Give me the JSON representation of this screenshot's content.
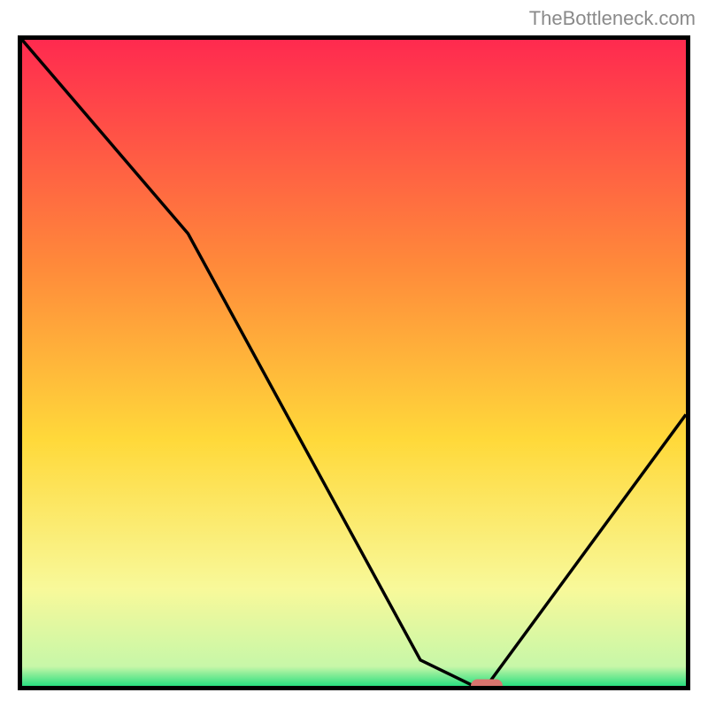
{
  "watermark": "TheBottleneck.com",
  "colors": {
    "border": "#000000",
    "curve": "#000000",
    "marker": "#d9746e",
    "gradient_top": "#ff2a4f",
    "gradient_mid_upper": "#ff8a3a",
    "gradient_mid": "#ffd93a",
    "gradient_lower": "#f8f99a",
    "gradient_bottom": "#2ade7f"
  },
  "chart_data": {
    "type": "line",
    "title": "",
    "xlabel": "",
    "ylabel": "",
    "xlim": [
      0,
      100
    ],
    "ylim": [
      0,
      100
    ],
    "x": [
      0,
      25,
      60,
      68,
      70,
      100
    ],
    "y": [
      100,
      70,
      4,
      0,
      0,
      42
    ],
    "marker": {
      "x": 70,
      "y": 0,
      "shape": "pill",
      "color": "#d9746e"
    },
    "annotations": []
  }
}
